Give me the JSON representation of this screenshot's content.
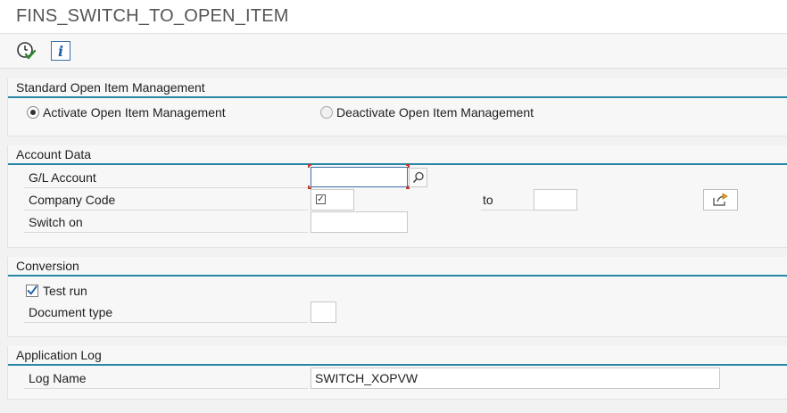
{
  "window": {
    "title": "FINS_SWITCH_TO_OPEN_ITEM"
  },
  "toolbar": {
    "execute_icon": "execute-clock-check-icon",
    "info_icon": "info-icon",
    "info_glyph": "i"
  },
  "groups": {
    "standard": {
      "title": "Standard Open Item Management",
      "activate_label": "Activate Open Item Management",
      "deactivate_label": "Deactivate Open Item Management",
      "selected": "activate"
    },
    "account_data": {
      "title": "Account Data",
      "gl_account_label": "G/L Account",
      "gl_account_value": "",
      "company_code_label": "Company Code",
      "company_code_value": "",
      "to_label": "to",
      "to_value": "",
      "switch_on_label": "Switch on",
      "switch_on_value": ""
    },
    "conversion": {
      "title": "Conversion",
      "test_run_label": "Test run",
      "test_run_checked": true,
      "document_type_label": "Document type",
      "document_type_value": ""
    },
    "application_log": {
      "title": "Application Log",
      "log_name_label": "Log Name",
      "log_name_value": "SWITCH_XOPVW"
    }
  },
  "colors": {
    "accent_line": "#2a86a7",
    "focus_corner": "#c0392b",
    "check_blue": "#1c5fa8"
  }
}
